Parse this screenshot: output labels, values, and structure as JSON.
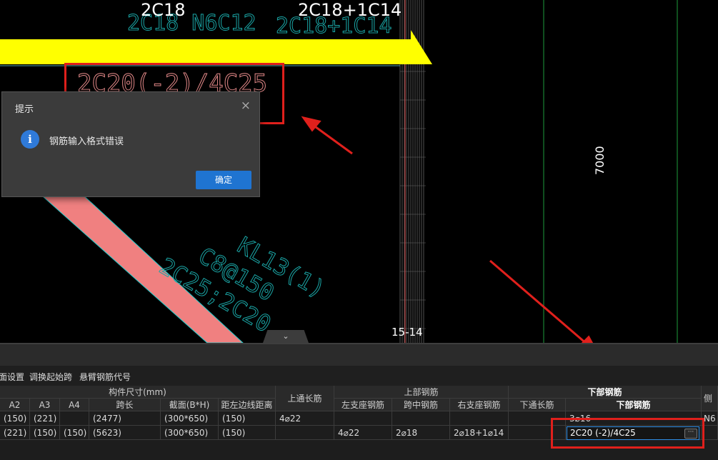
{
  "canvas": {
    "label_top_left": "2C18",
    "label_top_right": "2C18+1C14",
    "dim_label": "7000",
    "axis_label": "15-14",
    "collapse_glyph": "⌄",
    "colors": {
      "beam_yellow": "#ffff00",
      "beam_pink": "#f08080",
      "annotation_cyan": "#1aa6a6",
      "annotation_pink": "#e58a8a",
      "highlight_red": "#e0201c",
      "grid_green": "#1e9b3c"
    },
    "annotation_texts": {
      "beam_top_cyan": "2C18 N6C12",
      "beam_top_cyan_right": "2C18+1C14",
      "beam_pink_label": "2C20(-2)/4C25",
      "diagonal_1": "KL13(1)",
      "diagonal_2": "C8@150",
      "diagonal_3": "2C25;2C20"
    }
  },
  "dialog": {
    "title": "提示",
    "close_icon": "close-icon",
    "info_icon": "info-icon",
    "info_glyph": "i",
    "close_glyph": "×",
    "message": "钢筋输入格式错误",
    "ok_label": "确定",
    "button_color": "#1f74d1"
  },
  "toolbar": {
    "items": [
      "面设置",
      "调换起始跨",
      "悬臂钢筋代号"
    ]
  },
  "table": {
    "group_headers": {
      "size": "构件尺寸(mm)",
      "top_through": "上通长筋",
      "top_rebar": "上部钢筋",
      "bottom_group": "下部钢筋",
      "side": "侧"
    },
    "columns": [
      "A2",
      "A3",
      "A4",
      "跨长",
      "截面(B*H)",
      "距左边线距离",
      "左支座钢筋",
      "跨中钢筋",
      "右支座钢筋",
      "下通长筋",
      "下部钢筋"
    ],
    "rows": [
      {
        "a2": "(150)",
        "a3": "(221)",
        "a4": "",
        "span": "(2477)",
        "section": "(300*650)",
        "offset": "(150)",
        "top_through": "4⌀22",
        "left": "",
        "mid": "",
        "right": "",
        "bottom_through": "",
        "bottom": "3⌀16",
        "side": "N6"
      },
      {
        "a2": "(221)",
        "a3": "(150)",
        "a4": "(150)",
        "span": "(5623)",
        "section": "(300*650)",
        "offset": "(150)",
        "top_through": "",
        "left": "4⌀22",
        "mid": "2⌀18",
        "right": "2⌀18+1⌀14",
        "bottom_through": "",
        "bottom": "2C20 (-2)/4C25",
        "side": ""
      }
    ],
    "ellipsis": "···"
  }
}
